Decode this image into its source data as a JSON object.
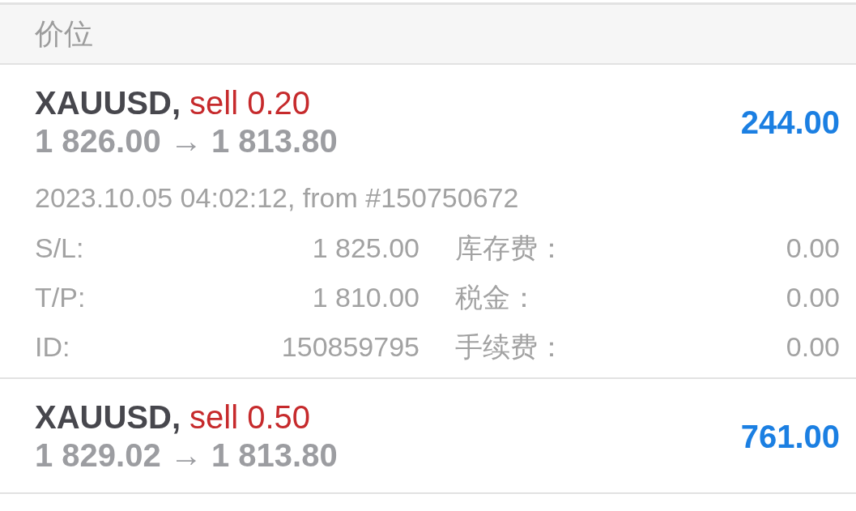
{
  "header": {
    "title": "价位"
  },
  "positions": [
    {
      "symbol": "XAUUSD,",
      "order": "sell 0.20",
      "prices": "1 826.00 → 1 813.80",
      "profit": "244.00",
      "expanded": true,
      "details": {
        "opened": "2023.10.05 04:02:12, from #150750672",
        "fields": [
          {
            "label": "S/L:",
            "value": "1 825.00"
          },
          {
            "label": "库存费：",
            "value": "0.00"
          },
          {
            "label": "T/P:",
            "value": "1 810.00"
          },
          {
            "label": "税金：",
            "value": "0.00"
          },
          {
            "label": "ID:",
            "value": "150859795"
          },
          {
            "label": "手续费：",
            "value": "0.00"
          }
        ]
      }
    },
    {
      "symbol": "XAUUSD,",
      "order": "sell 0.50",
      "prices": "1 829.02 → 1 813.80",
      "profit": "761.00",
      "expanded": false
    }
  ]
}
